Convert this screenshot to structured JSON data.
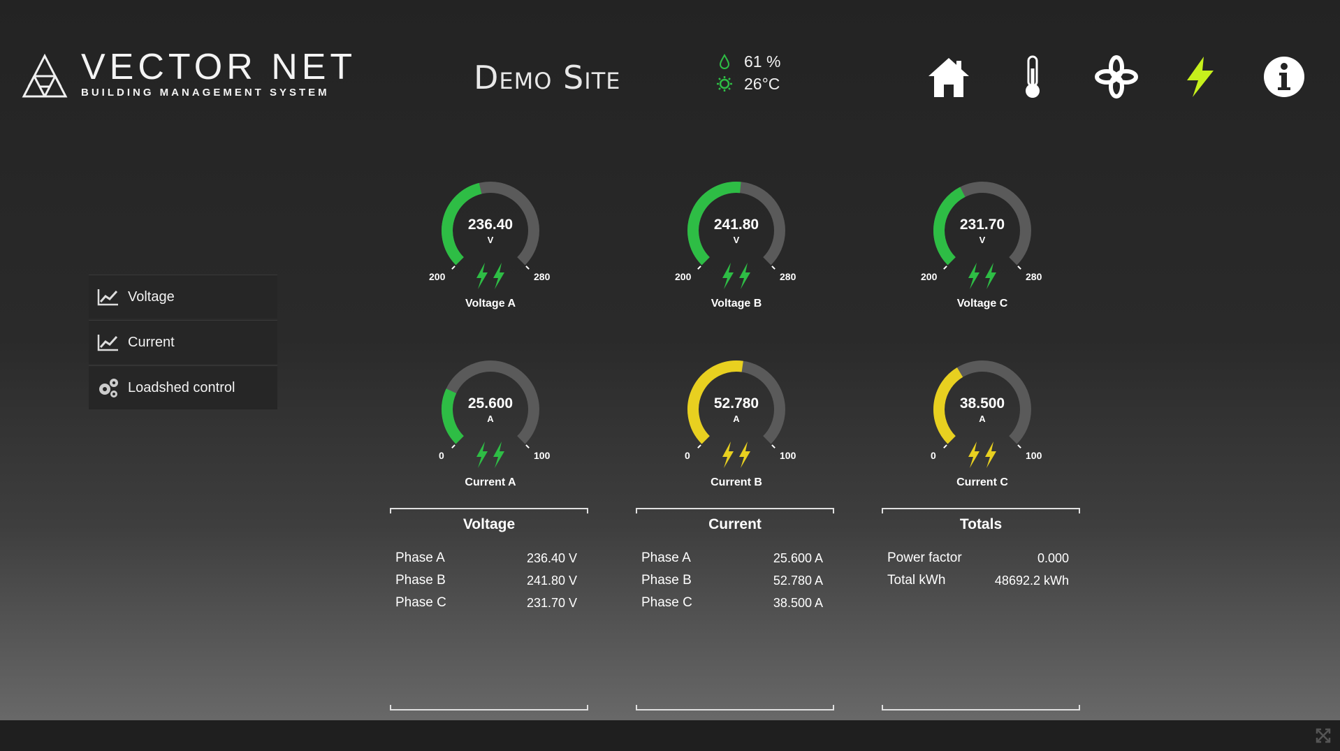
{
  "header": {
    "brand": "VECTOR NET",
    "brand_sub": "BUILDING MANAGEMENT SYSTEM",
    "site": "Demo Site",
    "humidity": "61 %",
    "temperature": "26°C",
    "nav": [
      "home-icon",
      "thermometer-icon",
      "fan-icon",
      "lightning-icon",
      "info-icon"
    ],
    "active_color": "#c6f01c"
  },
  "sidebar": {
    "items": [
      {
        "label": "Voltage",
        "icon": "chart-line-icon"
      },
      {
        "label": "Current",
        "icon": "chart-line-icon"
      },
      {
        "label": "Loadshed control",
        "icon": "gears-icon"
      }
    ]
  },
  "gauges": [
    {
      "value": "236.40",
      "unit": "V",
      "min": "200",
      "max": "280",
      "label": "Voltage A",
      "fill": 0.45,
      "color": "#2ebd45"
    },
    {
      "value": "241.80",
      "unit": "V",
      "min": "200",
      "max": "280",
      "label": "Voltage B",
      "fill": 0.52,
      "color": "#2ebd45"
    },
    {
      "value": "231.70",
      "unit": "V",
      "min": "200",
      "max": "280",
      "label": "Voltage C",
      "fill": 0.4,
      "color": "#2ebd45"
    },
    {
      "value": "25.600",
      "unit": "A",
      "min": "0",
      "max": "100",
      "label": "Current A",
      "fill": 0.26,
      "color": "#2ebd45"
    },
    {
      "value": "52.780",
      "unit": "A",
      "min": "0",
      "max": "100",
      "label": "Current B",
      "fill": 0.53,
      "color": "#e8d020"
    },
    {
      "value": "38.500",
      "unit": "A",
      "min": "0",
      "max": "100",
      "label": "Current C",
      "fill": 0.385,
      "color": "#e8d020"
    }
  ],
  "panels": [
    {
      "title": "Voltage",
      "rows": [
        {
          "k": "Phase A",
          "v": "236.40 V"
        },
        {
          "k": "Phase B",
          "v": "241.80 V"
        },
        {
          "k": "Phase C",
          "v": "231.70 V"
        }
      ]
    },
    {
      "title": "Current",
      "rows": [
        {
          "k": "Phase A",
          "v": "25.600 A"
        },
        {
          "k": "Phase B",
          "v": "52.780 A"
        },
        {
          "k": "Phase C",
          "v": "38.500 A"
        }
      ]
    },
    {
      "title": "Totals",
      "rows": [
        {
          "k": "Power factor",
          "v": "0.000"
        },
        {
          "k": "Total kWh",
          "v": "48692.2 kWh"
        }
      ]
    }
  ]
}
